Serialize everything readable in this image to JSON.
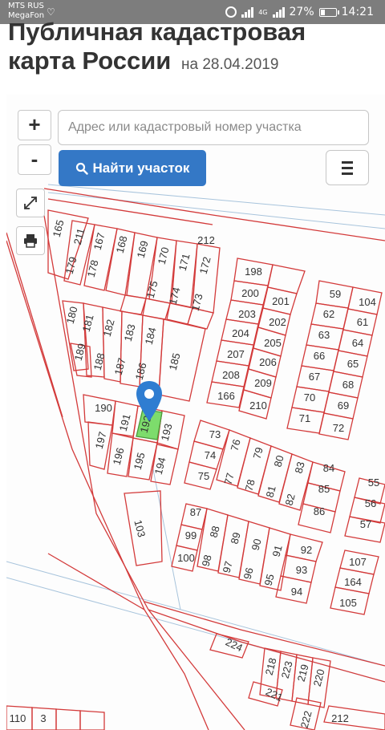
{
  "status_bar": {
    "carrier_1": "MTS RUS",
    "carrier_2": "MegaFon",
    "network": "4G",
    "battery": "27%",
    "time": "14:21"
  },
  "header": {
    "title_line1": "Публичная кадастровая",
    "title_line2": "карта России",
    "date": "на 28.04.2019"
  },
  "controls": {
    "zoom_in": "+",
    "zoom_out": "-",
    "search_placeholder": "Адрес или кадастровый номер участка",
    "search_value": "",
    "find_button": "Найти участок"
  },
  "colors": {
    "accent": "#3478c6",
    "parcel_border": "#d33a3a",
    "selected_parcel": "#7ddc6c",
    "pin": "#2f7dd1"
  },
  "icons": [
    "heart-icon",
    "alarm-icon",
    "signal-icon",
    "battery-icon",
    "search-icon",
    "menu-icon",
    "fullscreen-icon",
    "print-icon",
    "location-pin-icon"
  ],
  "map": {
    "selected_parcel": "192",
    "labels": [
      "165",
      "211",
      "167",
      "168",
      "169",
      "170",
      "171",
      "172",
      "212",
      "179",
      "178",
      "175",
      "174",
      "173",
      "198",
      "200",
      "201",
      "59",
      "104",
      "180",
      "181",
      "182",
      "183",
      "184",
      "203",
      "202",
      "62",
      "61",
      "189",
      "188",
      "187",
      "186",
      "185",
      "204",
      "205",
      "63",
      "64",
      "207",
      "206",
      "66",
      "65",
      "208",
      "209",
      "67",
      "68",
      "166",
      "210",
      "70",
      "69",
      "190",
      "191",
      "193",
      "71",
      "72",
      "197",
      "196",
      "195",
      "194",
      "73",
      "74",
      "75",
      "76",
      "77",
      "78",
      "79",
      "80",
      "81",
      "82",
      "83",
      "84",
      "85",
      "86",
      "55",
      "56",
      "57",
      "103",
      "87",
      "88",
      "89",
      "90",
      "91",
      "92",
      "93",
      "94",
      "95",
      "96",
      "97",
      "98",
      "99",
      "100",
      "107",
      "164",
      "105",
      "224",
      "218",
      "223",
      "219",
      "220",
      "221",
      "222",
      "110",
      "3",
      "212"
    ]
  }
}
